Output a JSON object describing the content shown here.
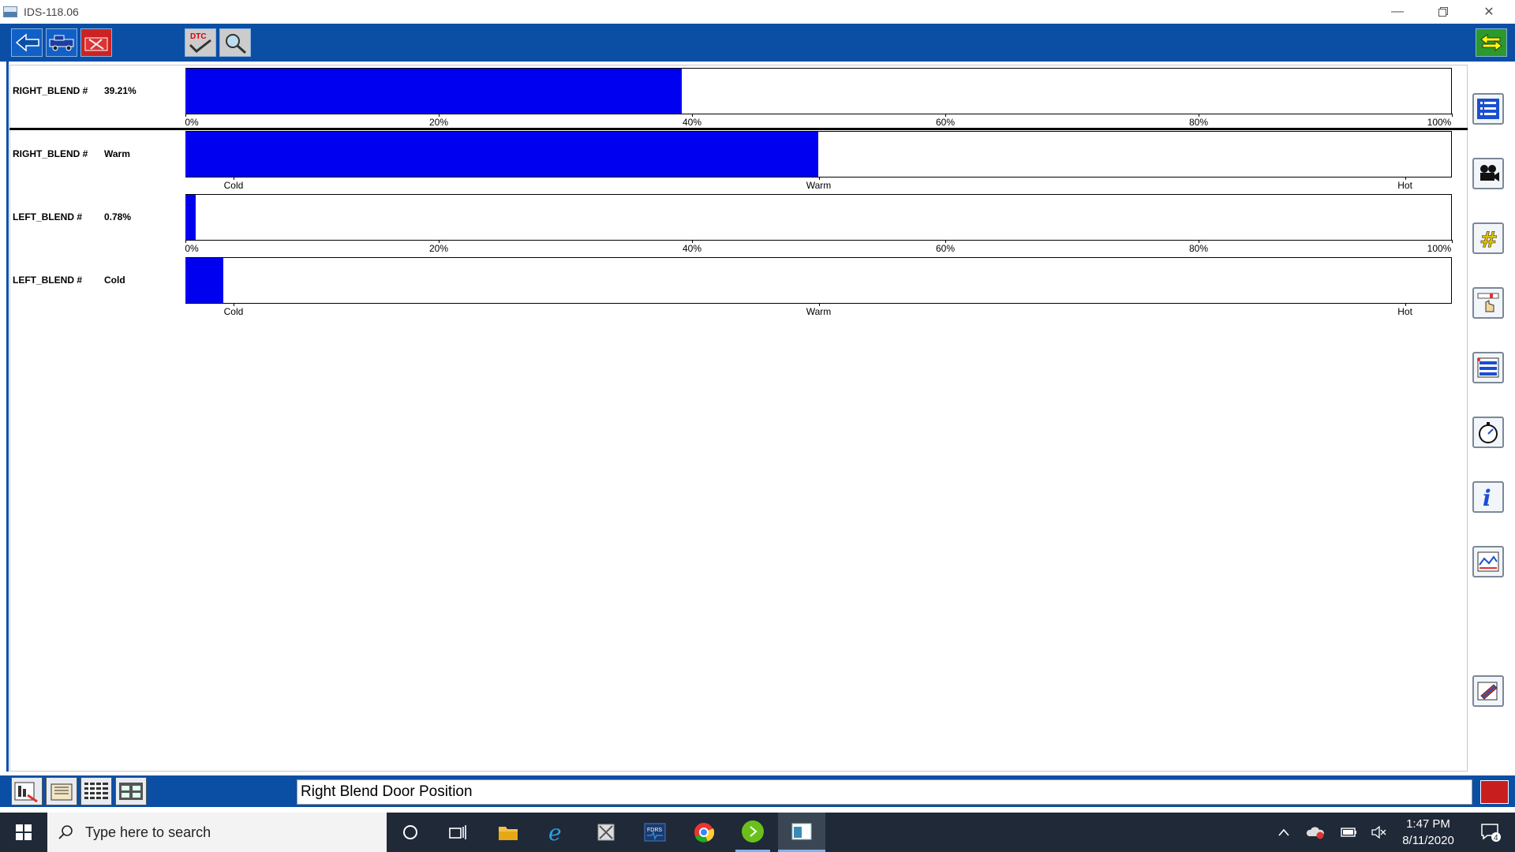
{
  "window": {
    "title": "IDS-118.06"
  },
  "rows": [
    {
      "name": "RIGHT_BLEND #",
      "value": "39.21%",
      "fill_fraction": 0.3921,
      "scale": "percent"
    },
    {
      "name": "RIGHT_BLEND #",
      "value": "Warm",
      "fill_fraction": 0.5,
      "scale": "temp"
    },
    {
      "name": "LEFT_BLEND #",
      "value": "0.78%",
      "fill_fraction": 0.0078,
      "scale": "percent"
    },
    {
      "name": "LEFT_BLEND #",
      "value": "Cold",
      "fill_fraction": 0.03,
      "scale": "temp"
    }
  ],
  "percent_ticks": [
    "0%",
    "20%",
    "40%",
    "60%",
    "80%",
    "100%"
  ],
  "temp_ticks": [
    "Cold",
    "Warm",
    "Hot"
  ],
  "status": {
    "text": "Right Blend Door Position"
  },
  "taskbar": {
    "search_placeholder": "Type here to search",
    "time": "1:47 PM",
    "date": "8/11/2020",
    "notifications": "4"
  },
  "colors": {
    "toolbar": "#0b4fa5",
    "bar_fill": "#0000f0",
    "taskbar": "#1f2937"
  }
}
